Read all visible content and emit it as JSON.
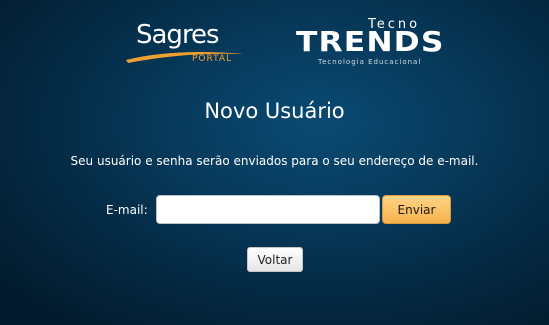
{
  "logos": {
    "sagres": {
      "name": "Sagres",
      "subtitle": "PORTAL",
      "swoosh_color": "#f0a030"
    },
    "tecnotrends": {
      "top": "Tecno",
      "main": "TRENDS",
      "subtitle": "Tecnologia Educacional"
    }
  },
  "page": {
    "title": "Novo Usuário",
    "info": "Seu usuário e senha serão enviados para o seu endereço de e-mail."
  },
  "form": {
    "email_label": "E-mail:",
    "email_value": "",
    "email_placeholder": "",
    "send_label": "Enviar",
    "back_label": "Voltar"
  },
  "colors": {
    "background_dark": "#021a2c",
    "background_light": "#0a4a73",
    "accent_button": "#f6b24d"
  }
}
